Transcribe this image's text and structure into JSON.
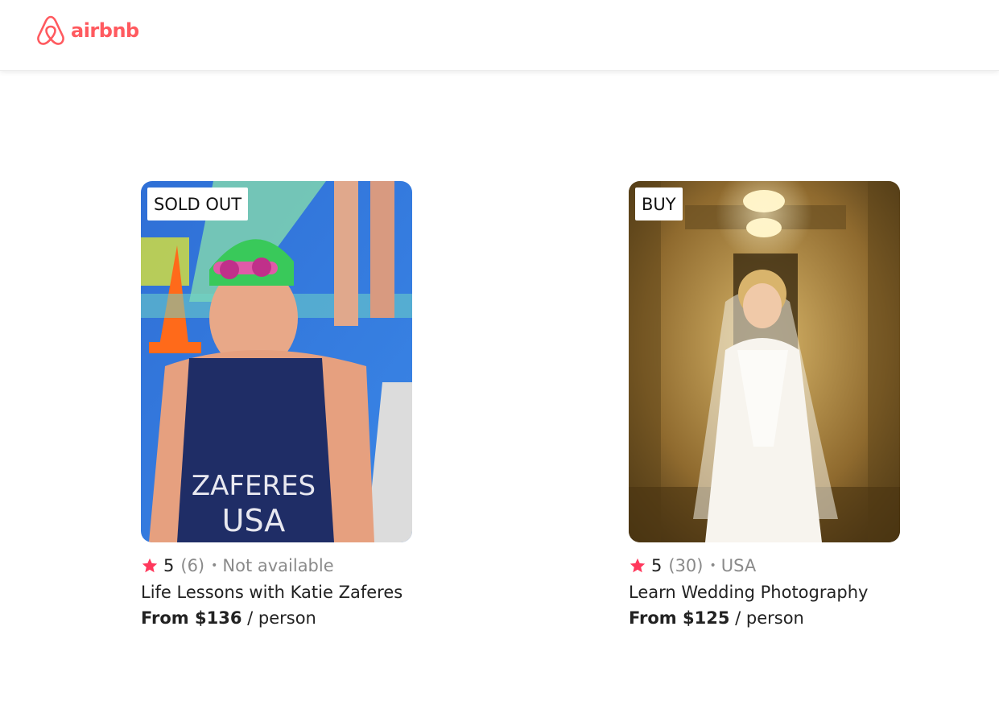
{
  "brand": {
    "name": "airbnb",
    "color": "#FF5A5F",
    "icon": "airbnb-logo-icon"
  },
  "listings": [
    {
      "badge": "SOLD OUT",
      "rating": "5",
      "reviews": "(6)",
      "separator": "•",
      "location": "Not available",
      "title": "Life Lessons with Katie Zaferes",
      "price": "From $136",
      "unit": "/ person",
      "photo_text": [
        "ZAFERES",
        "USA"
      ],
      "star_color": "#FF385C"
    },
    {
      "badge": "BUY",
      "rating": "5",
      "reviews": "(30)",
      "separator": "•",
      "location": "USA",
      "title": "Learn Wedding Photography",
      "price": "From $125",
      "unit": "/ person",
      "star_color": "#FF385C"
    }
  ]
}
